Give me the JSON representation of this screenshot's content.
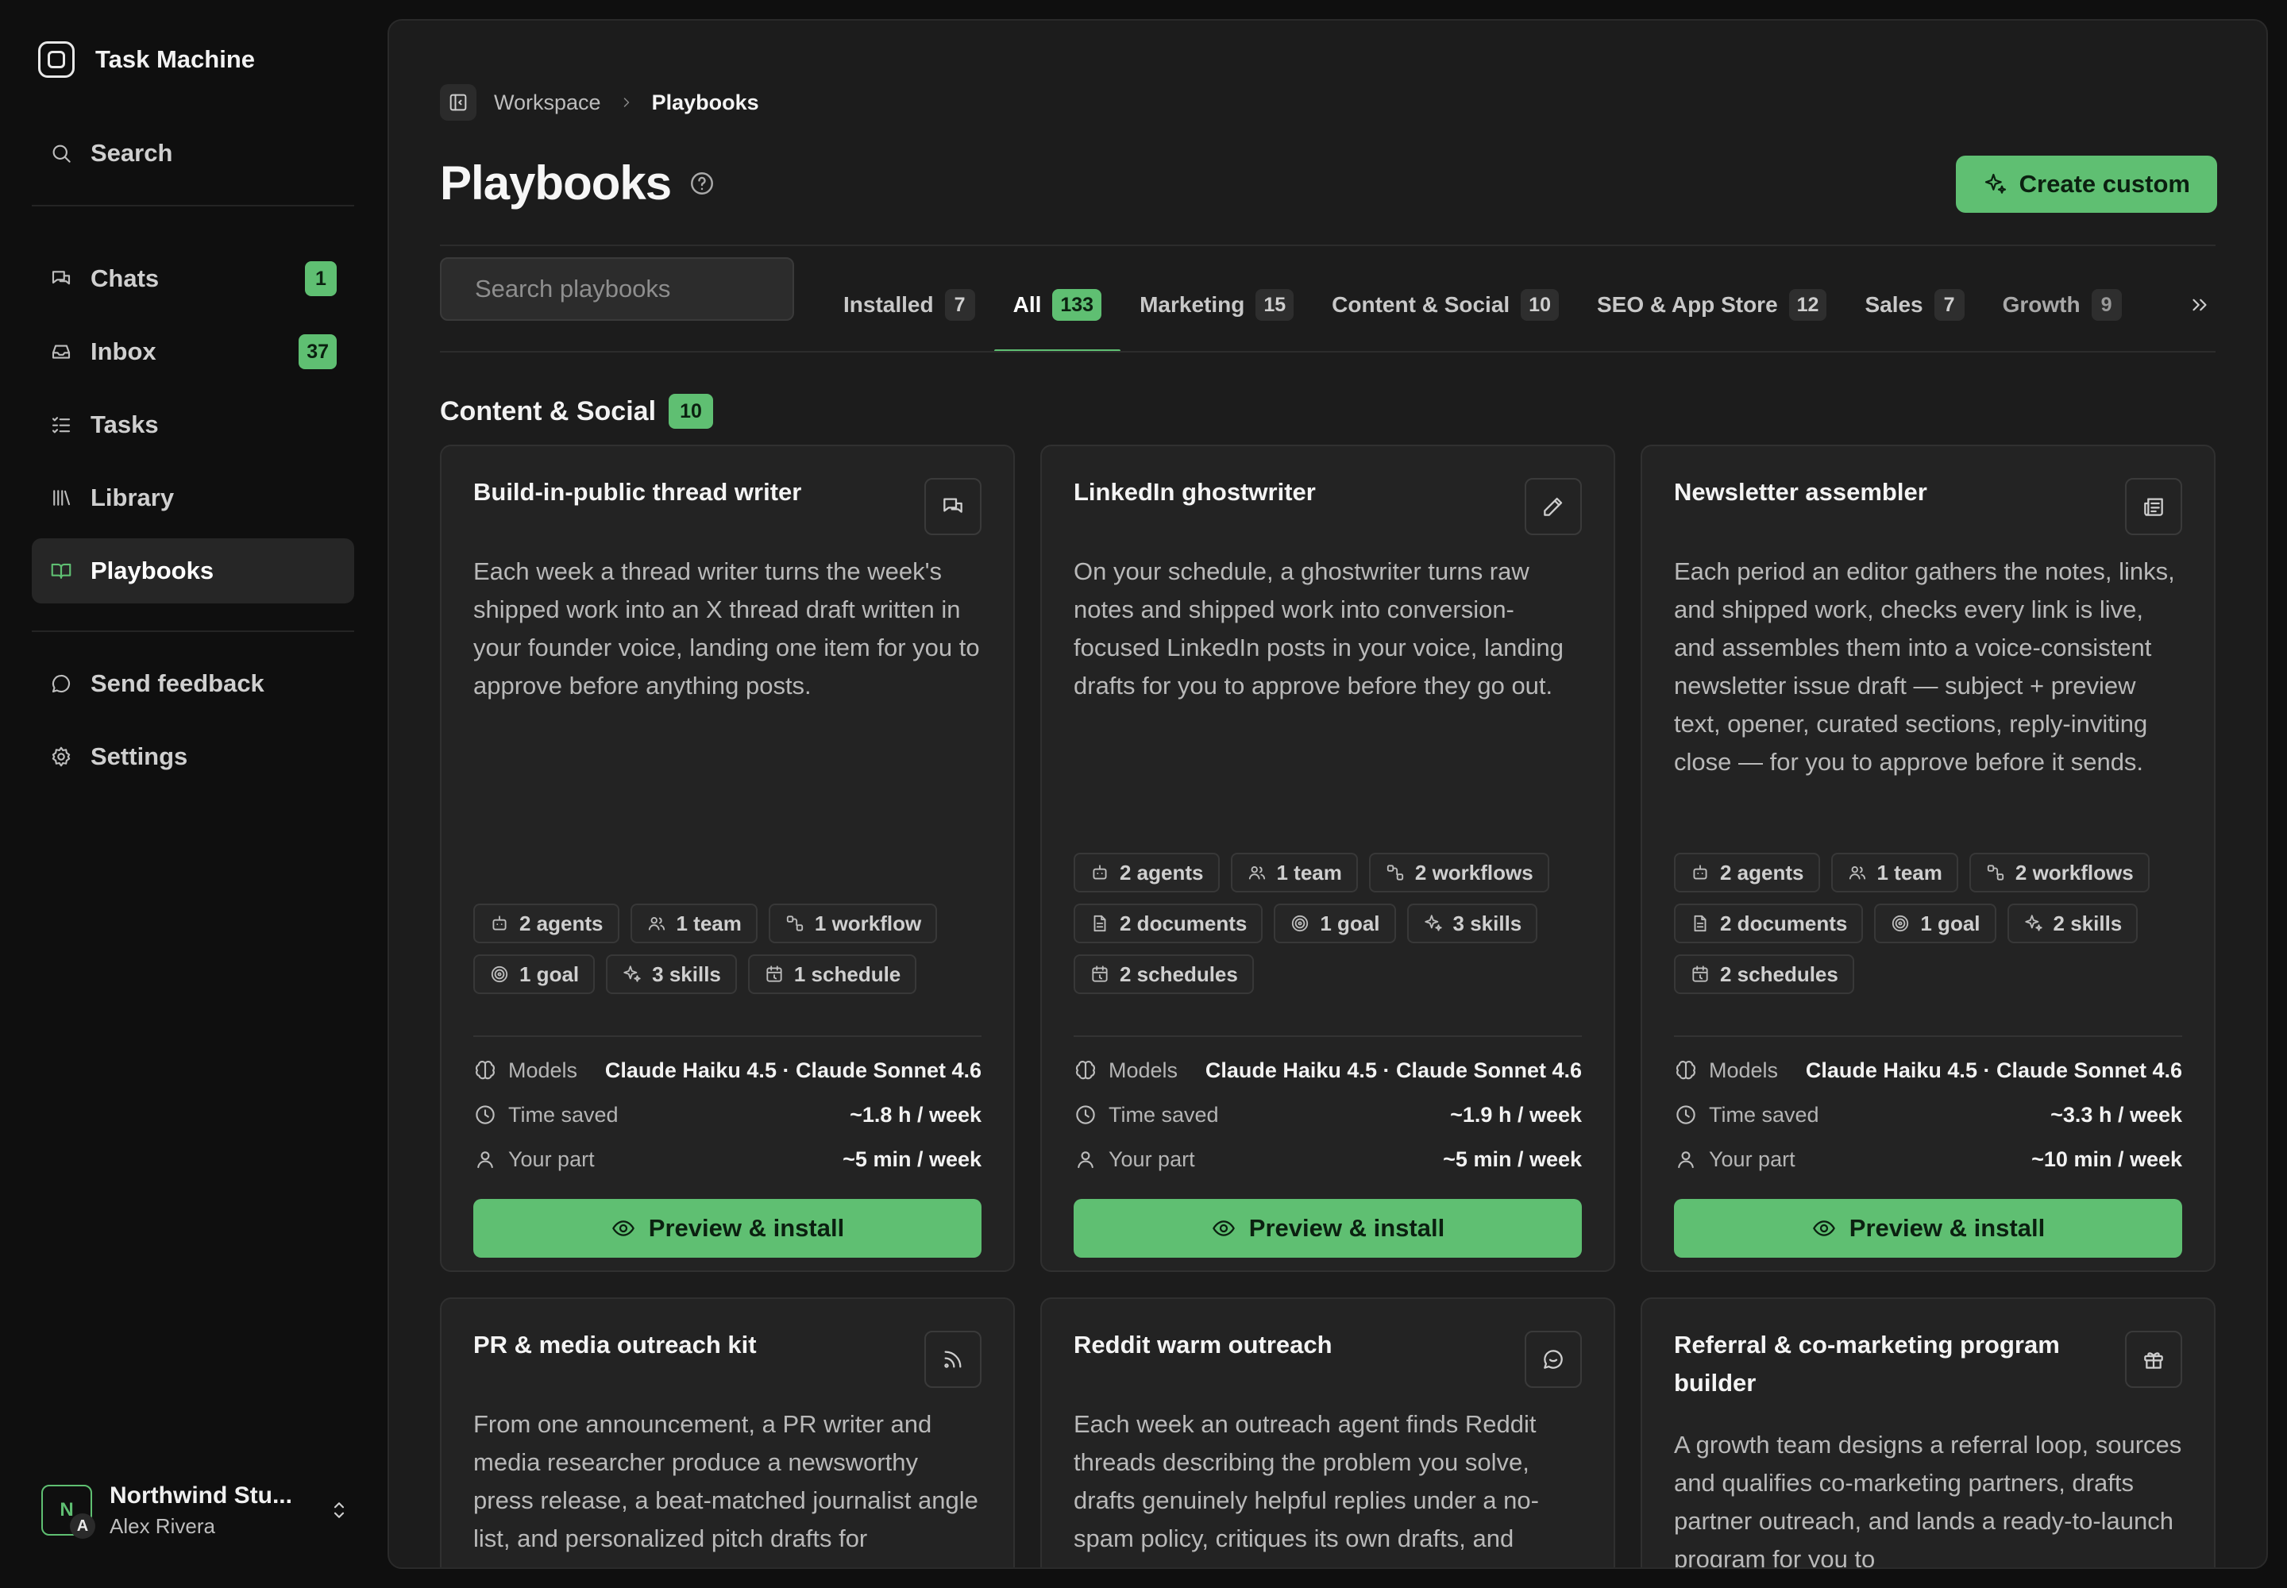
{
  "app": {
    "name": "Task Machine"
  },
  "sidebar": {
    "search_label": "Search",
    "items": [
      {
        "label": "Chats",
        "badge": "1"
      },
      {
        "label": "Inbox",
        "badge": "37"
      },
      {
        "label": "Tasks"
      },
      {
        "label": "Library"
      },
      {
        "label": "Playbooks",
        "active": true
      }
    ],
    "footer_items": [
      {
        "label": "Send feedback"
      },
      {
        "label": "Settings"
      }
    ],
    "account": {
      "org": "Northwind Stu...",
      "user": "Alex Rivera",
      "initial": "N",
      "sub_initial": "A"
    }
  },
  "breadcrumb": {
    "parent": "Workspace",
    "current": "Playbooks"
  },
  "header": {
    "title": "Playbooks",
    "create_label": "Create custom"
  },
  "search": {
    "placeholder": "Search playbooks"
  },
  "tabs": [
    {
      "label": "Installed",
      "count": "7"
    },
    {
      "label": "All",
      "count": "133",
      "active": true
    },
    {
      "label": "Marketing",
      "count": "15"
    },
    {
      "label": "Content & Social",
      "count": "10"
    },
    {
      "label": "SEO & App Store",
      "count": "12"
    },
    {
      "label": "Sales",
      "count": "7"
    },
    {
      "label": "Growth",
      "count": "9"
    }
  ],
  "section": {
    "title": "Content & Social",
    "count": "10"
  },
  "stat_labels": {
    "models": "Models",
    "time_saved": "Time saved",
    "your_part": "Your part"
  },
  "cards": [
    {
      "title": "Build-in-public thread writer",
      "icon": "message-icon",
      "description": "Each week a thread writer turns the week's shipped work into an X thread draft written in your founder voice, landing one item for you to approve before anything posts.",
      "chips": [
        {
          "icon": "agent-icon",
          "label": "2 agents"
        },
        {
          "icon": "team-icon",
          "label": "1 team"
        },
        {
          "icon": "workflow-icon",
          "label": "1 workflow"
        },
        {
          "icon": "goal-icon",
          "label": "1 goal"
        },
        {
          "icon": "skills-icon",
          "label": "3 skills"
        },
        {
          "icon": "schedule-icon",
          "label": "1 schedule"
        }
      ],
      "models": "Claude Haiku 4.5 · Claude Sonnet 4.6",
      "time_saved": "~1.8 h / week",
      "your_part": "~5 min / week",
      "button": "Preview & install"
    },
    {
      "title": "LinkedIn ghostwriter",
      "icon": "pen-icon",
      "description": "On your schedule, a ghostwriter turns raw notes and shipped work into conversion-focused LinkedIn posts in your voice, landing drafts for you to approve before they go out.",
      "chips": [
        {
          "icon": "agent-icon",
          "label": "2 agents"
        },
        {
          "icon": "team-icon",
          "label": "1 team"
        },
        {
          "icon": "workflow-icon",
          "label": "2 workflows"
        },
        {
          "icon": "document-icon",
          "label": "2 documents"
        },
        {
          "icon": "goal-icon",
          "label": "1 goal"
        },
        {
          "icon": "skills-icon",
          "label": "3 skills"
        },
        {
          "icon": "schedule-icon",
          "label": "2 schedules"
        }
      ],
      "models": "Claude Haiku 4.5 · Claude Sonnet 4.6",
      "time_saved": "~1.9 h / week",
      "your_part": "~5 min / week",
      "button": "Preview & install"
    },
    {
      "title": "Newsletter assembler",
      "icon": "newspaper-icon",
      "description": "Each period an editor gathers the notes, links, and shipped work, checks every link is live, and assembles them into a voice-consistent newsletter issue draft — subject + preview text, opener, curated sections, reply-inviting close — for you to approve before it sends.",
      "chips": [
        {
          "icon": "agent-icon",
          "label": "2 agents"
        },
        {
          "icon": "team-icon",
          "label": "1 team"
        },
        {
          "icon": "workflow-icon",
          "label": "2 workflows"
        },
        {
          "icon": "document-icon",
          "label": "2 documents"
        },
        {
          "icon": "goal-icon",
          "label": "1 goal"
        },
        {
          "icon": "skills-icon",
          "label": "2 skills"
        },
        {
          "icon": "schedule-icon",
          "label": "2 schedules"
        }
      ],
      "models": "Claude Haiku 4.5 · Claude Sonnet 4.6",
      "time_saved": "~3.3 h / week",
      "your_part": "~10 min / week",
      "button": "Preview & install"
    },
    {
      "title": "PR & media outreach kit",
      "icon": "rss-icon",
      "description": "From one announcement, a PR writer and media researcher produce a newsworthy press release, a beat-matched journalist angle list, and personalized pitch drafts for"
    },
    {
      "title": "Reddit warm outreach",
      "icon": "chat-bubble-icon",
      "description": "Each week an outreach agent finds Reddit threads describing the problem you solve, drafts genuinely helpful replies under a no-spam policy, critiques its own drafts, and"
    },
    {
      "title": "Referral & co-marketing program builder",
      "icon": "gift-icon",
      "description": "A growth team designs a referral loop, sources and qualifies co-marketing partners, drafts partner outreach, and lands a ready-to-launch program for you to"
    }
  ]
}
